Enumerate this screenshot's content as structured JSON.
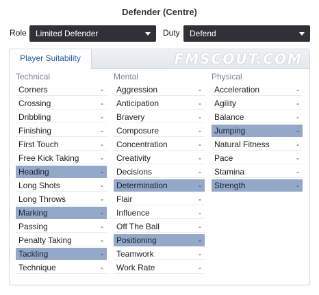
{
  "title": "Defender (Centre)",
  "role": {
    "label": "Role",
    "value": "Limited Defender"
  },
  "duty": {
    "label": "Duty",
    "value": "Defend"
  },
  "tab": {
    "label": "Player Suitability"
  },
  "watermark": "FMSCOUT.COM",
  "highlight_color": "#94a8c7",
  "columns": [
    {
      "heading": "Technical",
      "items": [
        {
          "name": "Corners",
          "value": "-",
          "highlighted": false
        },
        {
          "name": "Crossing",
          "value": "-",
          "highlighted": false
        },
        {
          "name": "Dribbling",
          "value": "-",
          "highlighted": false
        },
        {
          "name": "Finishing",
          "value": "-",
          "highlighted": false
        },
        {
          "name": "First Touch",
          "value": "-",
          "highlighted": false
        },
        {
          "name": "Free Kick Taking",
          "value": "-",
          "highlighted": false
        },
        {
          "name": "Heading",
          "value": "-",
          "highlighted": true
        },
        {
          "name": "Long Shots",
          "value": "-",
          "highlighted": false
        },
        {
          "name": "Long Throws",
          "value": "-",
          "highlighted": false
        },
        {
          "name": "Marking",
          "value": "-",
          "highlighted": true
        },
        {
          "name": "Passing",
          "value": "-",
          "highlighted": false
        },
        {
          "name": "Penalty Taking",
          "value": "-",
          "highlighted": false
        },
        {
          "name": "Tackling",
          "value": "-",
          "highlighted": true
        },
        {
          "name": "Technique",
          "value": "-",
          "highlighted": false
        }
      ]
    },
    {
      "heading": "Mental",
      "items": [
        {
          "name": "Aggression",
          "value": "-",
          "highlighted": false
        },
        {
          "name": "Anticipation",
          "value": "-",
          "highlighted": false
        },
        {
          "name": "Bravery",
          "value": "-",
          "highlighted": false
        },
        {
          "name": "Composure",
          "value": "-",
          "highlighted": false
        },
        {
          "name": "Concentration",
          "value": "-",
          "highlighted": false
        },
        {
          "name": "Creativity",
          "value": "-",
          "highlighted": false
        },
        {
          "name": "Decisions",
          "value": "-",
          "highlighted": false
        },
        {
          "name": "Determination",
          "value": "-",
          "highlighted": true
        },
        {
          "name": "Flair",
          "value": "-",
          "highlighted": false
        },
        {
          "name": "Influence",
          "value": "-",
          "highlighted": false
        },
        {
          "name": "Off The Ball",
          "value": "-",
          "highlighted": false
        },
        {
          "name": "Positioning",
          "value": "-",
          "highlighted": true
        },
        {
          "name": "Teamwork",
          "value": "-",
          "highlighted": false
        },
        {
          "name": "Work Rate",
          "value": "-",
          "highlighted": false
        }
      ]
    },
    {
      "heading": "Physical",
      "items": [
        {
          "name": "Acceleration",
          "value": "-",
          "highlighted": false
        },
        {
          "name": "Agility",
          "value": "-",
          "highlighted": false
        },
        {
          "name": "Balance",
          "value": "-",
          "highlighted": false
        },
        {
          "name": "Jumping",
          "value": "-",
          "highlighted": true
        },
        {
          "name": "Natural Fitness",
          "value": "-",
          "highlighted": false
        },
        {
          "name": "Pace",
          "value": "-",
          "highlighted": false
        },
        {
          "name": "Stamina",
          "value": "-",
          "highlighted": false
        },
        {
          "name": "Strength",
          "value": "-",
          "highlighted": true
        }
      ]
    }
  ]
}
